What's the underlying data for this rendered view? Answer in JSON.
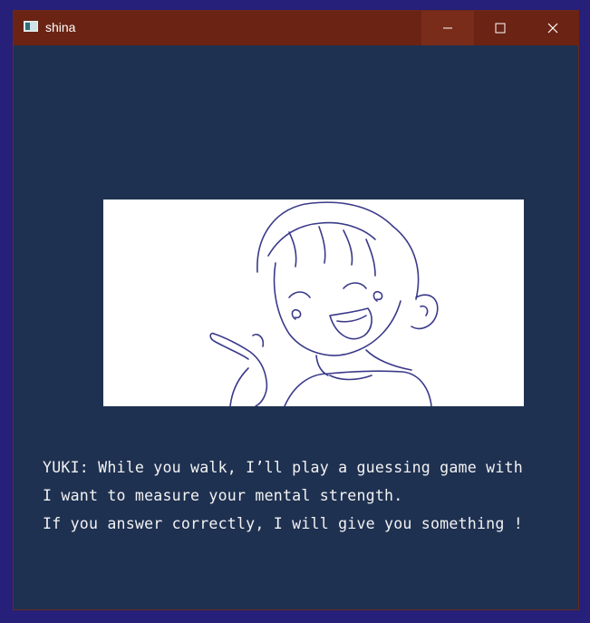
{
  "window": {
    "title": "shina",
    "controls": {
      "minimize_icon": "minimize-icon",
      "maximize_icon": "maximize-icon",
      "close_icon": "close-icon"
    }
  },
  "scene": {
    "illustration": "smiling-boy-pointing",
    "dialogue": {
      "lines": [
        "YUKI: While you walk, I’ll play a guessing game with",
        "I want to measure your mental strength.",
        "If you answer correctly, I will give you something !"
      ]
    }
  },
  "colors": {
    "titlebar": "#6b2313",
    "window_bg": "#1f3151",
    "outer_bg": "#26207a",
    "text": "#f2f2f2",
    "lineart": "#3a3a8a"
  }
}
